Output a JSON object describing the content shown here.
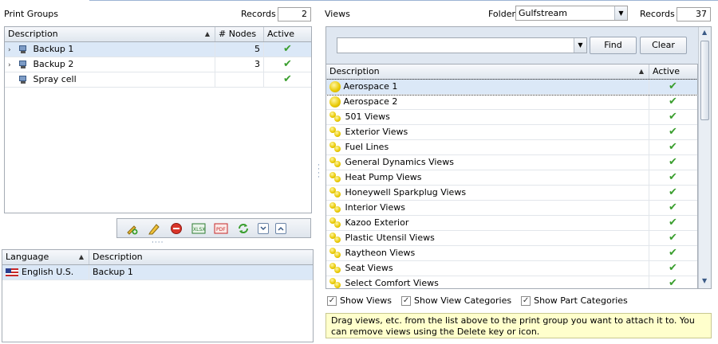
{
  "print_groups": {
    "title": "Print Groups",
    "records_label": "Records",
    "records_value": "2",
    "columns": [
      "Description",
      "# Nodes",
      "Active"
    ],
    "rows": [
      {
        "description": "Backup 1",
        "nodes": "5",
        "active": true,
        "expandable": true
      },
      {
        "description": "Backup 2",
        "nodes": "3",
        "active": true,
        "expandable": true
      },
      {
        "description": "Spray cell",
        "nodes": "",
        "active": true,
        "expandable": false
      }
    ]
  },
  "toolbar": {
    "icons": [
      "add-icon",
      "edit-icon",
      "delete-icon",
      "export-excel-icon",
      "export-pdf-icon",
      "refresh-icon",
      "collapse-icon",
      "expand-icon"
    ],
    "xlsx_label": "XLSX",
    "pdf_label": "PDF"
  },
  "language_grid": {
    "columns": [
      "Language",
      "Description"
    ],
    "rows": [
      {
        "language": "English U.S.",
        "description": "Backup 1"
      }
    ]
  },
  "views": {
    "title": "Views",
    "folder_label": "Folder",
    "folder_value": "Gulfstream",
    "records_label": "Records",
    "records_value": "37",
    "search_value": "",
    "find_label": "Find",
    "clear_label": "Clear",
    "columns": [
      "Description",
      "Active"
    ],
    "rows": [
      {
        "description": "Aerospace 1",
        "icon": "view-icon",
        "active": true
      },
      {
        "description": "Aerospace 2",
        "icon": "view-icon",
        "active": true
      },
      {
        "description": "501 Views",
        "icon": "view-category-icon",
        "active": true
      },
      {
        "description": "Exterior Views",
        "icon": "view-category-icon",
        "active": true
      },
      {
        "description": "Fuel Lines",
        "icon": "view-category-icon",
        "active": true
      },
      {
        "description": "General Dynamics Views",
        "icon": "view-category-icon",
        "active": true
      },
      {
        "description": "Heat Pump Views",
        "icon": "view-category-icon",
        "active": true
      },
      {
        "description": "Honeywell Sparkplug Views",
        "icon": "view-category-icon",
        "active": true
      },
      {
        "description": "Interior Views",
        "icon": "view-category-icon",
        "active": true
      },
      {
        "description": "Kazoo Exterior",
        "icon": "view-category-icon",
        "active": true
      },
      {
        "description": "Plastic Utensil Views",
        "icon": "view-category-icon",
        "active": true
      },
      {
        "description": "Raytheon Views",
        "icon": "view-category-icon",
        "active": true
      },
      {
        "description": "Seat Views",
        "icon": "view-category-icon",
        "active": true
      },
      {
        "description": "Select Comfort Views",
        "icon": "view-category-icon",
        "active": true
      }
    ],
    "checkboxes": [
      {
        "label": "Show Views",
        "checked": true
      },
      {
        "label": "Show View Categories",
        "checked": true
      },
      {
        "label": "Show Part Categories",
        "checked": true
      }
    ],
    "hint": "Drag views, etc. from the list above to the print group you want to attach it to. You can remove views using the Delete key or icon."
  }
}
